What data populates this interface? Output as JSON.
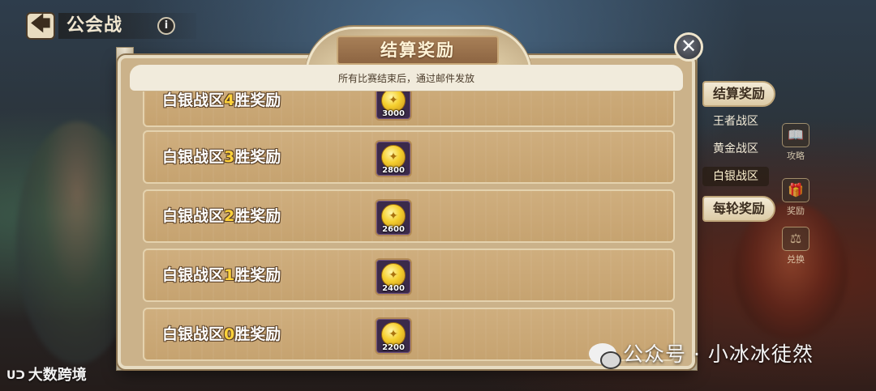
{
  "nav": {
    "back_glyph": "🡄",
    "title": "公会战",
    "info_glyph": "i"
  },
  "dialog": {
    "title": "结算奖励",
    "subtitle": "所有比赛结束后，通过邮件发放",
    "close_glyph": "✕"
  },
  "rewards": [
    {
      "zone": "白银战区",
      "wins": "4",
      "suffix": "胜奖励",
      "amount": "3000"
    },
    {
      "zone": "白银战区",
      "wins": "3",
      "suffix": "胜奖励",
      "amount": "2800"
    },
    {
      "zone": "白银战区",
      "wins": "2",
      "suffix": "胜奖励",
      "amount": "2600"
    },
    {
      "zone": "白银战区",
      "wins": "1",
      "suffix": "胜奖励",
      "amount": "2400"
    },
    {
      "zone": "白银战区",
      "wins": "0",
      "suffix": "胜奖励",
      "amount": "2200"
    }
  ],
  "coin_icon": "coin-icon",
  "side_tabs": {
    "settlement": "结算奖励",
    "zones": [
      "王者战区",
      "黄金战区",
      "白银战区"
    ],
    "active_zone_index": 2,
    "per_round": "每轮奖励"
  },
  "side_icons": [
    {
      "name": "guide",
      "label": "攻略",
      "glyph": "📖"
    },
    {
      "name": "reward",
      "label": "奖励",
      "glyph": "🎁"
    },
    {
      "name": "exchange",
      "label": "兑换",
      "glyph": "⚖"
    }
  ],
  "watermarks": {
    "left_logo": "ᑌᑐ",
    "left_text": "大数跨境",
    "right_text": "公众号 · 小冰冰徒然"
  },
  "colors": {
    "accent_gold": "#ffd23a",
    "panel_bg": "#cbb28a",
    "row_bg": "#c6a370"
  }
}
